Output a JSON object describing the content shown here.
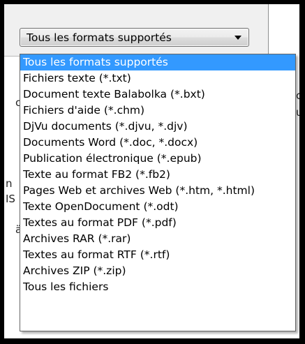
{
  "combo": {
    "selected_value": "Tous les formats supportés",
    "arrow_icon": "chevron-down-icon"
  },
  "dropdown": {
    "highlight_color": "#3399ff",
    "options": [
      "Tous les formats supportés",
      "Fichiers texte (*.txt)",
      "Document texte Balabolka (*.bxt)",
      "Fichiers d'aide (*.chm)",
      "DjVu documents (*.djvu, *.djv)",
      "Documents Word (*.doc, *.docx)",
      "Publication électronique (*.epub)",
      "Texte au format FB2 (*.fb2)",
      "Pages Web et archives Web (*.htm, *.html)",
      "Texte OpenDocument (*.odt)",
      "Textes au format PDF (*.pdf)",
      "Archives RAR (*.rar)",
      "Textes au format RTF (*.rtf)",
      "Archives ZIP (*.zip)",
      "Tous les fichiers"
    ]
  }
}
